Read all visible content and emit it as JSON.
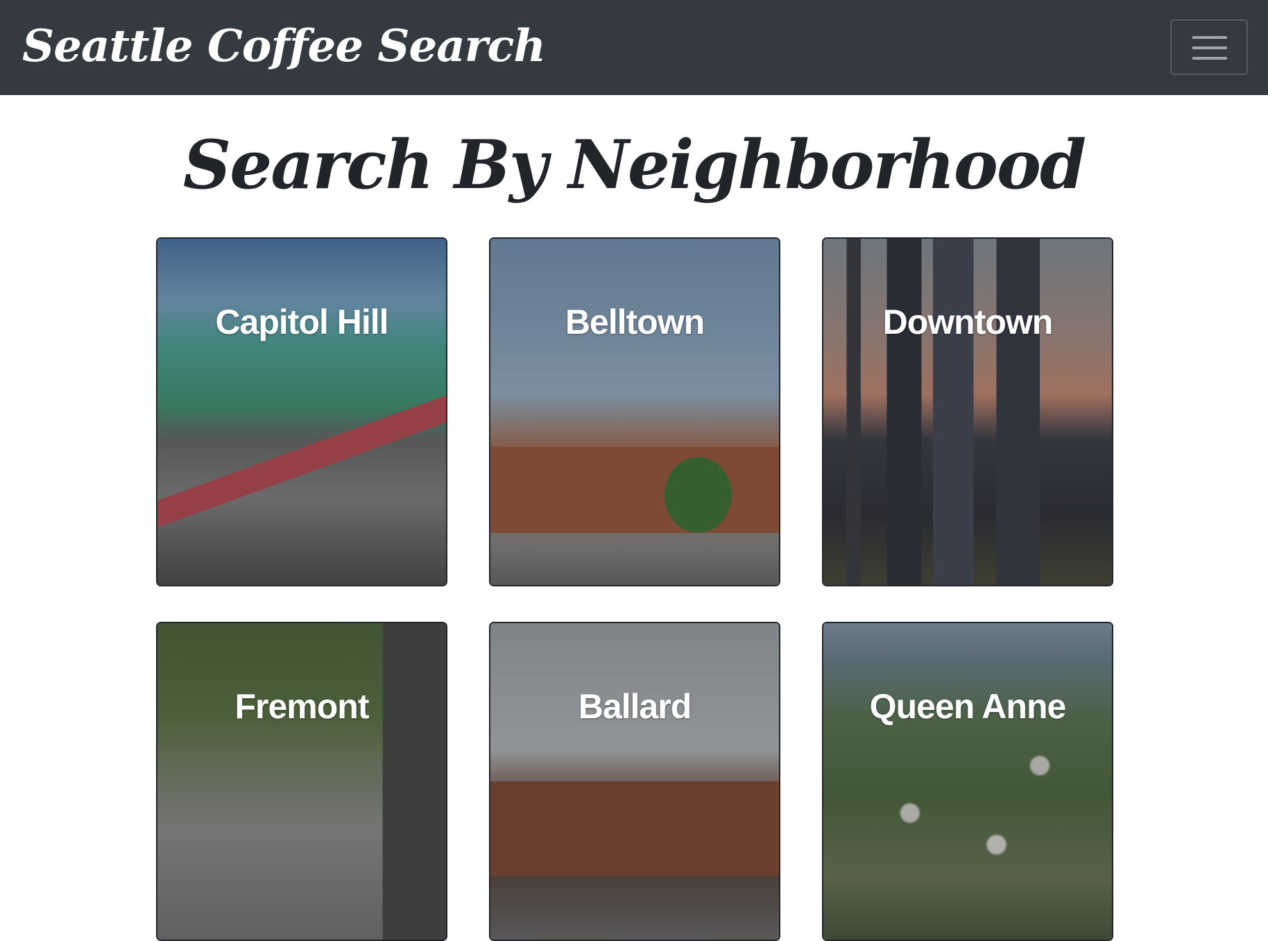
{
  "navbar": {
    "brand": "Seattle Coffee Search",
    "toggler_icon": "hamburger-menu-icon"
  },
  "main": {
    "heading": "Search By Neighborhood",
    "neighborhoods": [
      {
        "name": "Capitol Hill"
      },
      {
        "name": "Belltown"
      },
      {
        "name": "Downtown"
      },
      {
        "name": "Fremont"
      },
      {
        "name": "Ballard"
      },
      {
        "name": "Queen Anne"
      }
    ]
  },
  "colors": {
    "navbar_bg": "#343a40",
    "heading_text": "#212529",
    "card_title_text": "#ffffff"
  }
}
